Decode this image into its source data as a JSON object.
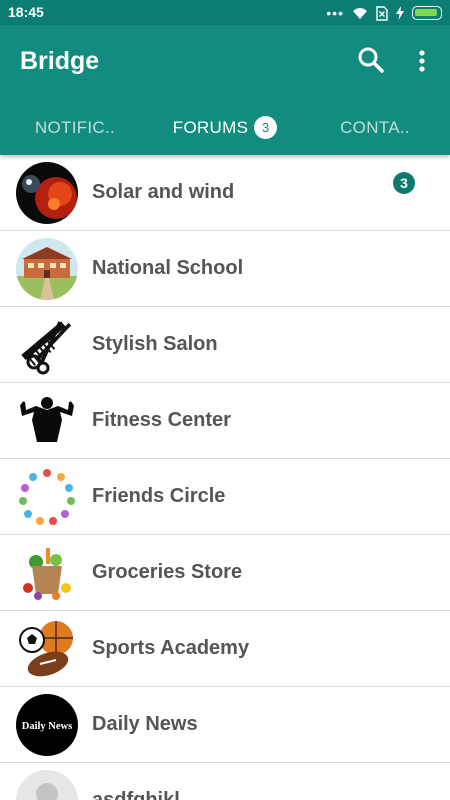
{
  "status_bar": {
    "time": "18:45",
    "dots": "•••"
  },
  "app_bar": {
    "title": "Bridge"
  },
  "tabs": [
    {
      "label": "NOTIFIC..",
      "active": false
    },
    {
      "label": "FORUMS",
      "active": true,
      "badge": "3"
    },
    {
      "label": "CONTA..",
      "active": false
    }
  ],
  "forums": [
    {
      "name": "Solar and wind",
      "unread": "3",
      "icon": "solar-wind-icon"
    },
    {
      "name": "National School",
      "icon": "school-icon"
    },
    {
      "name": "Stylish Salon",
      "icon": "scissors-comb-icon"
    },
    {
      "name": "Fitness Center",
      "icon": "bodybuilder-icon"
    },
    {
      "name": "Friends Circle",
      "icon": "friends-circle-icon"
    },
    {
      "name": "Groceries Store",
      "icon": "grocery-bag-icon"
    },
    {
      "name": "Sports Academy",
      "icon": "sports-balls-icon"
    },
    {
      "name": "Daily News",
      "icon": "daily-news-logo",
      "logo_text": "Daily News"
    },
    {
      "name": "asdfghjkl",
      "icon": "default-avatar-icon"
    }
  ],
  "colors": {
    "primary": "#128c7e",
    "status_bar": "#0b7d72",
    "badge": "#0d7a70",
    "item_text": "#555555"
  }
}
